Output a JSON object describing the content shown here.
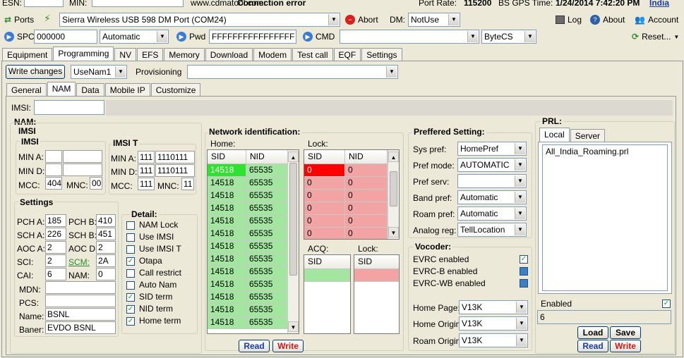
{
  "top": {
    "esn_label": "ESN:",
    "min_label": "MIN:",
    "website": "www.cdmatool.com:",
    "status": "Connection error",
    "port_rate_label": "Port Rate:",
    "port_rate": "115200",
    "gps_label": "BS GPS Time:",
    "gps_time": "1/24/2014 7:42:20 PM",
    "region": "India"
  },
  "toolbar1": {
    "ports_label": "Ports",
    "port_select": "Sierra Wireless USB 598 DM Port (COM24)",
    "abort_label": "Abort",
    "dm_label": "DM:",
    "dm_select": "NotUse",
    "log_label": "Log",
    "about_label": "About",
    "account_label": "Account"
  },
  "toolbar2": {
    "spc_label": "SPC",
    "spc_value": "000000",
    "spc_mode": "Automatic",
    "pwd_label": "Pwd",
    "pwd_value": "FFFFFFFFFFFFFFFF",
    "cmd_label": "CMD",
    "cmd_value": "",
    "cmd_type": "ByteCS",
    "reset_label": "Reset..."
  },
  "main_tabs": [
    "Equipment",
    "Programming",
    "NV",
    "EFS",
    "Memory",
    "Download",
    "Modem",
    "Test call",
    "EQF",
    "Settings"
  ],
  "prog_bar": {
    "write_changes": "Write changes",
    "user_select": "UseNam1",
    "provisioning_label": "Provisioning",
    "provisioning_select": ""
  },
  "sub_tabs": [
    "General",
    "NAM",
    "Data",
    "Mobile IP",
    "Customize"
  ],
  "imsi_top": {
    "label": "IMSI:",
    "value": ""
  },
  "nam": {
    "title": "NAM:",
    "imsi_title": "IMSI",
    "imsi_sub": "IMSI",
    "min_a_label": "MIN A:",
    "min_a_1": "",
    "min_a_2": "",
    "min_d_label": "MIN D:",
    "min_d_1": "",
    "min_d_2": "",
    "mcc_label": "MCC:",
    "mcc": "404",
    "mnc_label": "MNC:",
    "mnc": "00",
    "imsi_t_title": "IMSI T",
    "t_min_a_label": "MIN A:",
    "t_min_a_1": "111",
    "t_min_a_2": "1110111",
    "t_min_d_label": "MIN D:",
    "t_min_d_1": "111",
    "t_min_d_2": "1110111",
    "t_mcc_label": "MCC:",
    "t_mcc": "111",
    "t_mnc_label": "MNC:",
    "t_mnc": "11"
  },
  "settings": {
    "title": "Settings",
    "pch_a_label": "PCH A:",
    "pch_a": "185",
    "pch_b_label": "PCH B:",
    "pch_b": "410",
    "sch_a_label": "SCH A:",
    "sch_a": "226",
    "sch_b_label": "SCH B:",
    "sch_b": "451",
    "aoc_a_label": "AOC A:",
    "aoc_a": "2",
    "aoc_d_label": "AOC D:",
    "aoc_d": "2",
    "sci_label": "SCI:",
    "sci": "2",
    "scm_label": "SCM:",
    "scm": "2A",
    "cai_label": "CAI:",
    "cai": "6",
    "nam_label": "NAM:",
    "nam": "0",
    "mdn_label": "MDN:",
    "mdn": "",
    "pcs_label": "PCS:",
    "pcs": "",
    "name_label": "Name:",
    "name": "BSNL",
    "baner_label": "Baner:",
    "baner": "EVDO BSNL"
  },
  "detail": {
    "title": "Detail:",
    "items": [
      {
        "label": "NAM Lock",
        "checked": false
      },
      {
        "label": "Use IMSI",
        "checked": false
      },
      {
        "label": "Use IMSI T",
        "checked": false
      },
      {
        "label": "Otapa",
        "checked": true
      },
      {
        "label": "Call restrict",
        "checked": false
      },
      {
        "label": "Auto Nam",
        "checked": false
      },
      {
        "label": "SID term",
        "checked": true
      },
      {
        "label": "NID term",
        "checked": true
      },
      {
        "label": "Home term",
        "checked": true
      }
    ]
  },
  "network": {
    "title": "Network identification:",
    "home_label": "Home:",
    "lock_label": "Lock:",
    "acq_label": "ACQ:",
    "lock2_label": "Lock:",
    "sid_header": "SID",
    "nid_header": "NID",
    "home_rows": [
      [
        "14518",
        "65535"
      ],
      [
        "14518",
        "65535"
      ],
      [
        "14518",
        "65535"
      ],
      [
        "14518",
        "65535"
      ],
      [
        "14518",
        "65535"
      ],
      [
        "14518",
        "65535"
      ],
      [
        "14518",
        "65535"
      ],
      [
        "14518",
        "65535"
      ],
      [
        "14518",
        "65535"
      ],
      [
        "14518",
        "65535"
      ],
      [
        "14518",
        "65535"
      ],
      [
        "14518",
        "65535"
      ],
      [
        "14518",
        "65535"
      ]
    ],
    "lock_rows": [
      [
        "0",
        "0"
      ],
      [
        "0",
        "0"
      ],
      [
        "0",
        "0"
      ],
      [
        "0",
        "0"
      ],
      [
        "0",
        "0"
      ],
      [
        "0",
        "0"
      ]
    ],
    "read_label": "Read",
    "write_label": "Write"
  },
  "preferred": {
    "title": "Preffered Setting:",
    "sys_pref_label": "Sys pref:",
    "sys_pref": "HomePref",
    "pref_mode_label": "Pref mode:",
    "pref_mode": "AUTOMATIC",
    "pref_serv_label": "Pref serv:",
    "pref_serv": "",
    "band_pref_label": "Band pref:",
    "band_pref": "Automatic",
    "roam_pref_label": "Roam pref:",
    "roam_pref": "Automatic",
    "analog_reg_label": "Analog reg:",
    "analog_reg": "TellLocation"
  },
  "vocoder": {
    "title": "Vocoder:",
    "evrc_label": "EVRC enabled",
    "evrcb_label": "EVRC-B enabled",
    "evrcwb_label": "EVRC-WB enabled",
    "home_page_label": "Home Page:",
    "home_page": "V13K",
    "home_origin_label": "Home Origin:",
    "home_origin": "V13K",
    "roam_origin_label": "Roam Origin:",
    "roam_origin": "V13K"
  },
  "prl": {
    "title": "PRL:",
    "tabs": [
      "Local",
      "Server"
    ],
    "list_item": "All_India_Roaming.prl",
    "enabled_label": "Enabled",
    "enabled_value": "6",
    "load_label": "Load",
    "save_label": "Save",
    "read_label": "Read",
    "write_label": "Write"
  }
}
